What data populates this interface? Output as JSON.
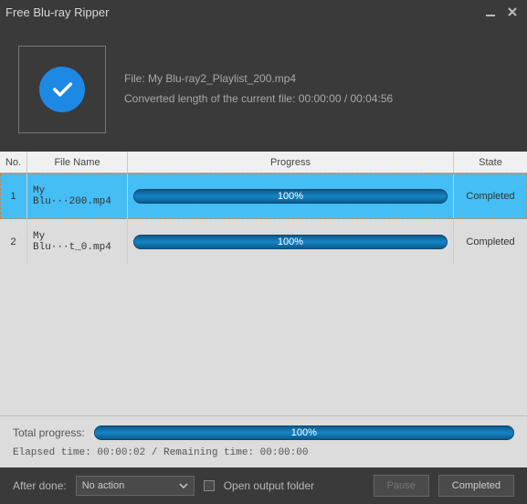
{
  "titlebar": {
    "title": "Free Blu-ray Ripper"
  },
  "info": {
    "file_line": "File: My Blu-ray2_Playlist_200.mp4",
    "conv_line": "Converted length of the current file: 00:00:00 / 00:04:56"
  },
  "table": {
    "headers": {
      "no": "No.",
      "name": "File Name",
      "progress": "Progress",
      "state": "State"
    },
    "rows": [
      {
        "no": "1",
        "name": "My Blu···200.mp4",
        "percent": "100%",
        "state": "Completed",
        "selected": true
      },
      {
        "no": "2",
        "name": "My Blu···t_0.mp4",
        "percent": "100%",
        "state": "Completed",
        "selected": false
      }
    ]
  },
  "totals": {
    "label": "Total progress:",
    "percent": "100%",
    "time_line": "Elapsed time: 00:00:02 / Remaining time: 00:00:00"
  },
  "footer": {
    "after_done_label": "After done:",
    "after_done_value": "No action",
    "open_folder_label": "Open output folder",
    "pause": "Pause",
    "completed": "Completed"
  }
}
